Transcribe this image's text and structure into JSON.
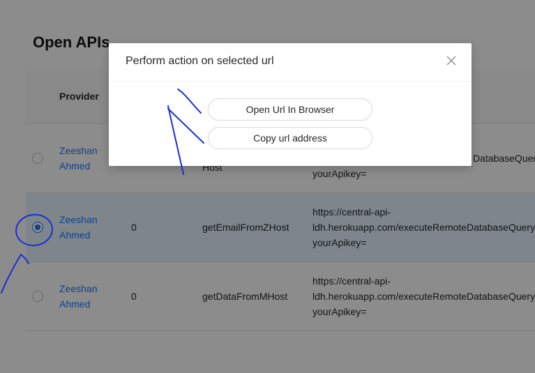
{
  "page": {
    "title": "Open APIs"
  },
  "table": {
    "headers": {
      "provider": "Provider"
    },
    "rows": [
      {
        "provider_first": "Zeeshan",
        "provider_last": "Ahmed",
        "count": "",
        "name": "Host",
        "url": "yourApikey=",
        "selected": false
      },
      {
        "provider_first": "Zeeshan",
        "provider_last": "Ahmed",
        "count": "0",
        "name": "getEmailFromZHost",
        "url": "https://central-api-\nldh.herokuapp.com/executeRemoteDatabaseQuery\nyourApikey=",
        "selected": true
      },
      {
        "provider_first": "Zeeshan",
        "provider_last": "Ahmed",
        "count": "0",
        "name": "getDataFromMHost",
        "url": "https://central-api-\nldh.herokuapp.com/executeRemoteDatabaseQuery\nyourApikey=",
        "selected": false
      }
    ],
    "row1_partial_url": "DatabaseQuery"
  },
  "modal": {
    "title": "Perform action on selected url",
    "open_label": "Open Url In Browser",
    "copy_label": "Copy url address"
  },
  "icons": {
    "close": "close-icon",
    "radio": "radio-icon"
  },
  "colors": {
    "link": "#1677ff",
    "annotation": "#1a2fd6",
    "selected_row": "#e6f4ff"
  }
}
